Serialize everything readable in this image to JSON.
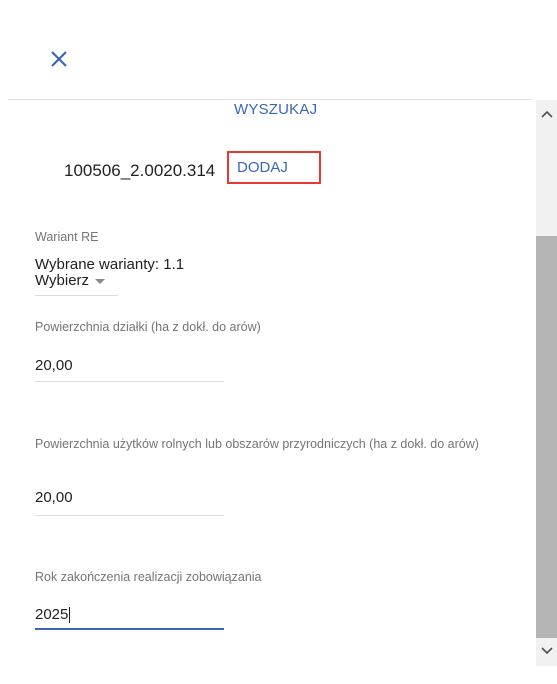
{
  "header": {
    "close_icon": "close-icon"
  },
  "search": {
    "label": "WYSZUKAJ"
  },
  "parcel": {
    "number": "100506_2.0020.314",
    "add_label": "DODAJ"
  },
  "variant": {
    "label": "Wariant RE",
    "selected_text": "Wybrane warianty: 1.1",
    "select_label": "Wybierz"
  },
  "fields": [
    {
      "label": "Powierzchnia działki (ha z dokł. do arów)",
      "value": "20,00"
    },
    {
      "label": "Powierzchnia użytków rolnych lub obszarów przyrodniczych (ha z dokł. do arów)",
      "value": "20,00"
    },
    {
      "label": "Rok zakończenia realizacji zobowiązania",
      "value": "2025"
    }
  ],
  "colors": {
    "accent": "#3a66b7",
    "highlight": "#e53935"
  }
}
